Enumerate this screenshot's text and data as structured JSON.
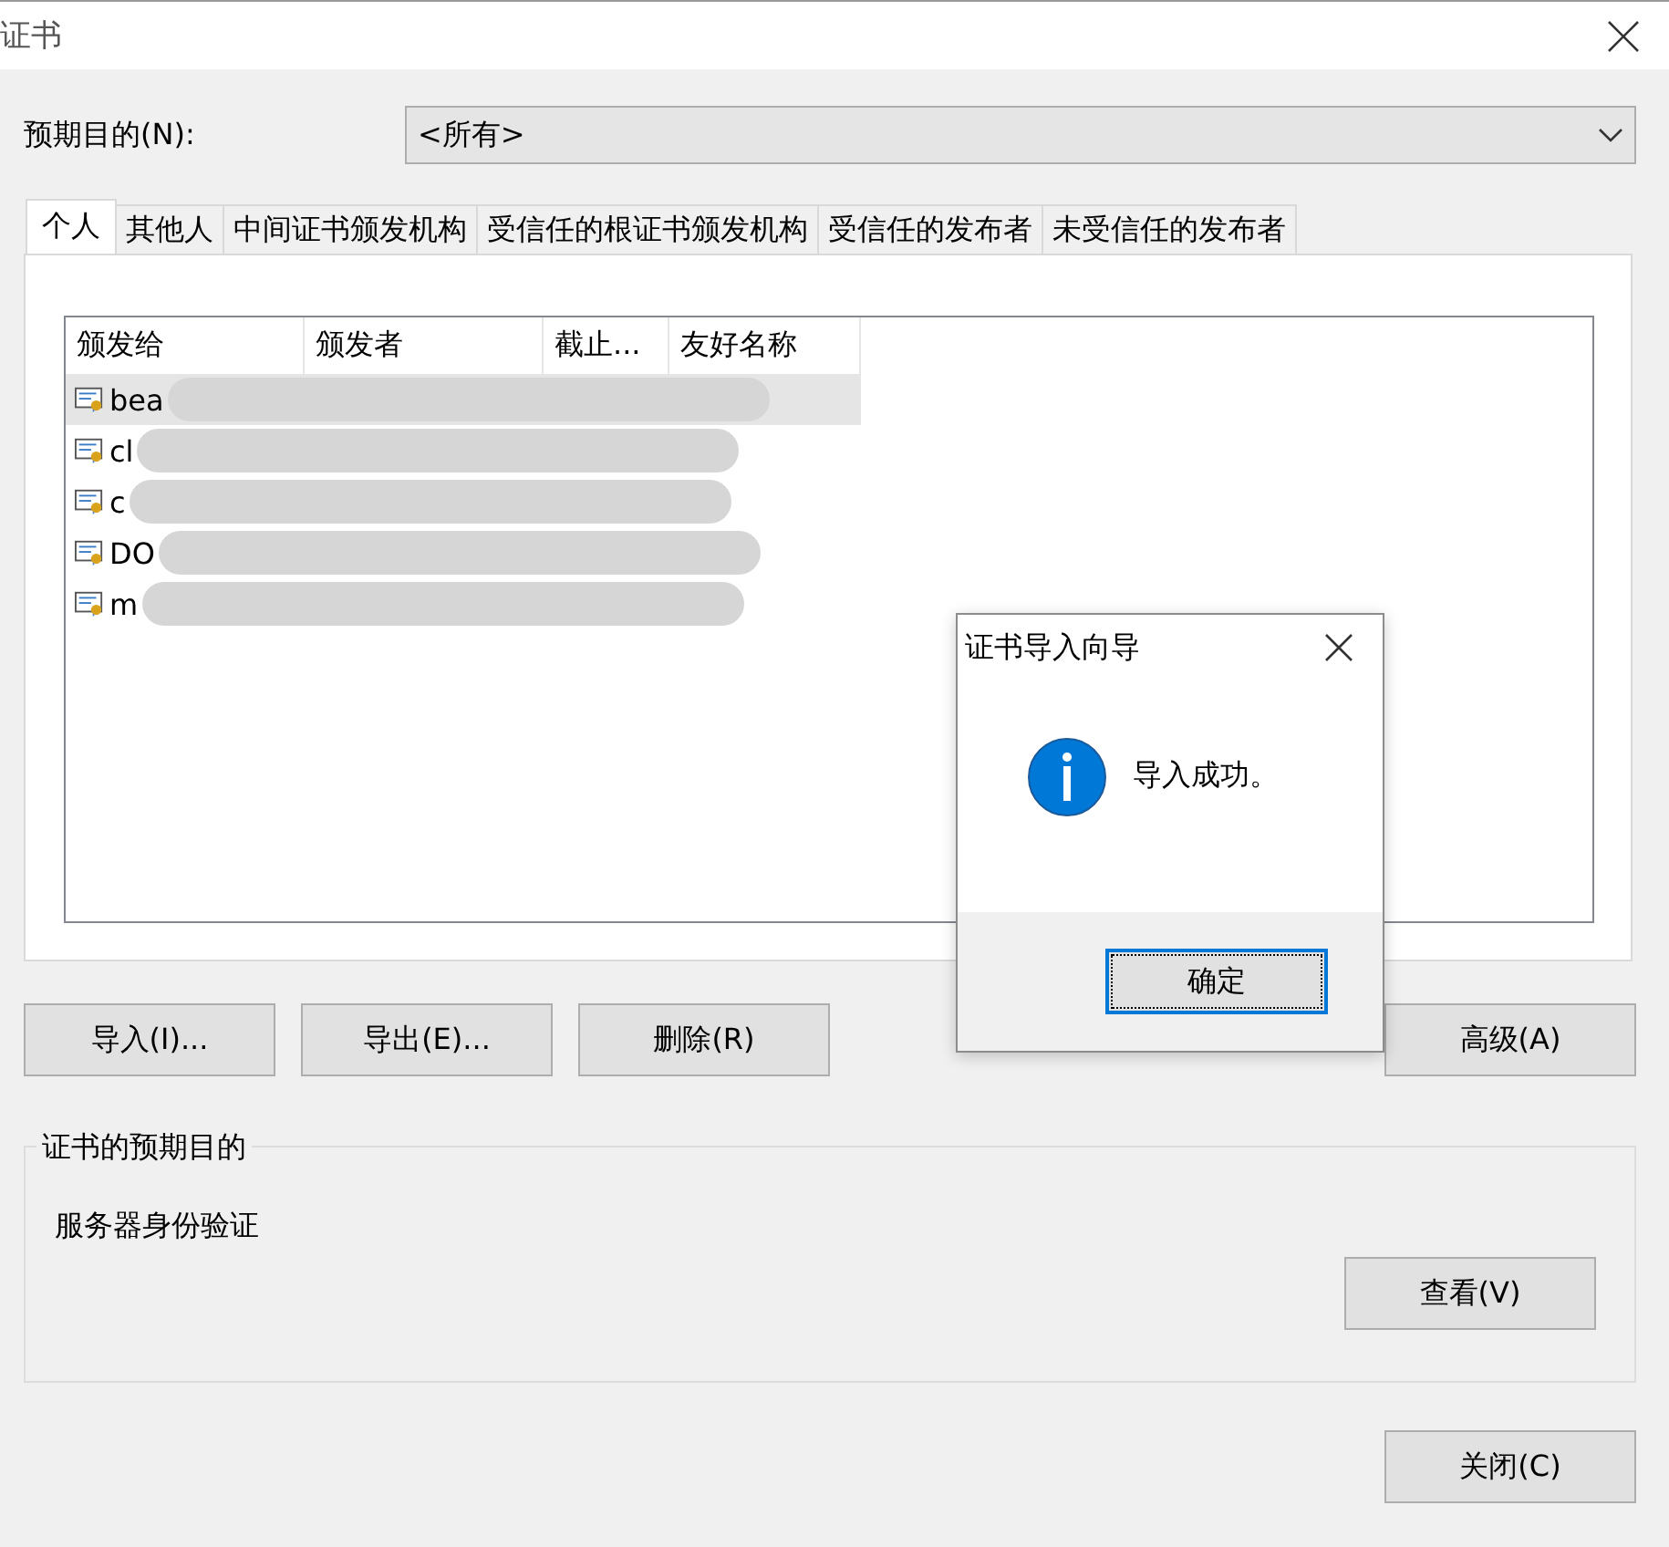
{
  "window": {
    "title": "证书"
  },
  "purpose": {
    "label": "预期目的(N):",
    "value": "<所有>"
  },
  "tabs": [
    {
      "label": "个人",
      "selected": true
    },
    {
      "label": "其他人",
      "selected": false
    },
    {
      "label": "中间证书颁发机构",
      "selected": false
    },
    {
      "label": "受信任的根证书颁发机构",
      "selected": false
    },
    {
      "label": "受信任的发布者",
      "selected": false
    },
    {
      "label": "未受信任的发布者",
      "selected": false
    }
  ],
  "table": {
    "columns": [
      "颁发给",
      "颁发者",
      "截止...",
      "友好名称"
    ],
    "rows": [
      {
        "issued_to": "bea",
        "selected": true
      },
      {
        "issued_to": "cl",
        "selected": false
      },
      {
        "issued_to": "c",
        "selected": false
      },
      {
        "issued_to": "DO",
        "selected": false
      },
      {
        "issued_to": "m",
        "selected": false
      }
    ]
  },
  "buttons": [
    "导入(I)...",
    "导出(E)...",
    "删除(R)",
    "高级(A)"
  ],
  "purposes_group": {
    "legend": "证书的预期目的",
    "text": "服务器身份验证",
    "button": "查看(V)"
  },
  "close_button": "关闭(C)",
  "dialog": {
    "title": "证书导入向导",
    "message": "导入成功。",
    "button": "确定"
  }
}
